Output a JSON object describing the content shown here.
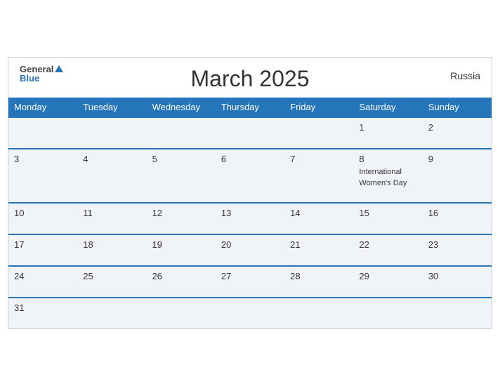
{
  "header": {
    "title": "March 2025",
    "country": "Russia",
    "logo_general": "General",
    "logo_blue": "Blue"
  },
  "weekdays": [
    "Monday",
    "Tuesday",
    "Wednesday",
    "Thursday",
    "Friday",
    "Saturday",
    "Sunday"
  ],
  "weeks": [
    [
      {
        "day": "",
        "event": ""
      },
      {
        "day": "",
        "event": ""
      },
      {
        "day": "",
        "event": ""
      },
      {
        "day": "",
        "event": ""
      },
      {
        "day": "",
        "event": ""
      },
      {
        "day": "1",
        "event": ""
      },
      {
        "day": "2",
        "event": ""
      }
    ],
    [
      {
        "day": "3",
        "event": ""
      },
      {
        "day": "4",
        "event": ""
      },
      {
        "day": "5",
        "event": ""
      },
      {
        "day": "6",
        "event": ""
      },
      {
        "day": "7",
        "event": ""
      },
      {
        "day": "8",
        "event": "International Women's Day"
      },
      {
        "day": "9",
        "event": ""
      }
    ],
    [
      {
        "day": "10",
        "event": ""
      },
      {
        "day": "11",
        "event": ""
      },
      {
        "day": "12",
        "event": ""
      },
      {
        "day": "13",
        "event": ""
      },
      {
        "day": "14",
        "event": ""
      },
      {
        "day": "15",
        "event": ""
      },
      {
        "day": "16",
        "event": ""
      }
    ],
    [
      {
        "day": "17",
        "event": ""
      },
      {
        "day": "18",
        "event": ""
      },
      {
        "day": "19",
        "event": ""
      },
      {
        "day": "20",
        "event": ""
      },
      {
        "day": "21",
        "event": ""
      },
      {
        "day": "22",
        "event": ""
      },
      {
        "day": "23",
        "event": ""
      }
    ],
    [
      {
        "day": "24",
        "event": ""
      },
      {
        "day": "25",
        "event": ""
      },
      {
        "day": "26",
        "event": ""
      },
      {
        "day": "27",
        "event": ""
      },
      {
        "day": "28",
        "event": ""
      },
      {
        "day": "29",
        "event": ""
      },
      {
        "day": "30",
        "event": ""
      }
    ],
    [
      {
        "day": "31",
        "event": ""
      },
      {
        "day": "",
        "event": ""
      },
      {
        "day": "",
        "event": ""
      },
      {
        "day": "",
        "event": ""
      },
      {
        "day": "",
        "event": ""
      },
      {
        "day": "",
        "event": ""
      },
      {
        "day": "",
        "event": ""
      }
    ]
  ],
  "colors": {
    "header_bg": "#2475ba",
    "row_bg": "#f0f4f8",
    "accent": "#2475ba"
  }
}
